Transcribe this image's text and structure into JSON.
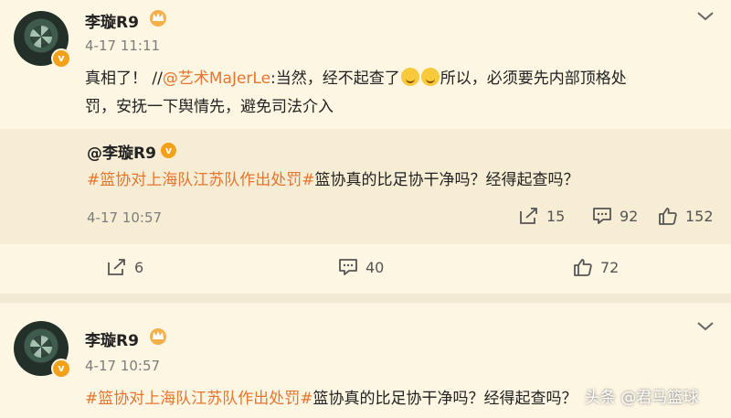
{
  "post1": {
    "username": "李璇R9",
    "timestamp": "4-17 11:11",
    "content": {
      "line1_prefix": "真相了！ //",
      "mention": "@艺术MaJerLe",
      "line1_after_mention": ":当然，经不起查了",
      "line1_suffix": "所以，必须要先内部顶格处",
      "line2": "罚，安抚一下舆情先，避免司法介入"
    },
    "repost": {
      "user": "@李璇R9",
      "hashtag": "#篮协对上海队江苏队作出处罚#",
      "text": "篮协真的比足协干净吗？经得起查吗？",
      "timestamp": "4-17 10:57",
      "stats": {
        "reposts": "15",
        "comments": "92",
        "likes": "152"
      }
    },
    "stats": {
      "reposts": "6",
      "comments": "40",
      "likes": "72"
    }
  },
  "post2": {
    "username": "李璇R9",
    "timestamp": "4-17 10:57",
    "hashtag": "#篮协对上海队江苏队作出处罚#",
    "text": "篮协真的比足协干净吗？经得起查吗？"
  },
  "watermark": "头条 @君马篮球",
  "colors": {
    "background": "#FDF6E3",
    "accent": "#E8742D",
    "badge": "#F4A11A"
  },
  "icons": [
    "crown-icon",
    "chevron-down-icon",
    "verified-badge-icon",
    "repost-icon",
    "comment-icon",
    "like-icon",
    "emoji-icon"
  ]
}
